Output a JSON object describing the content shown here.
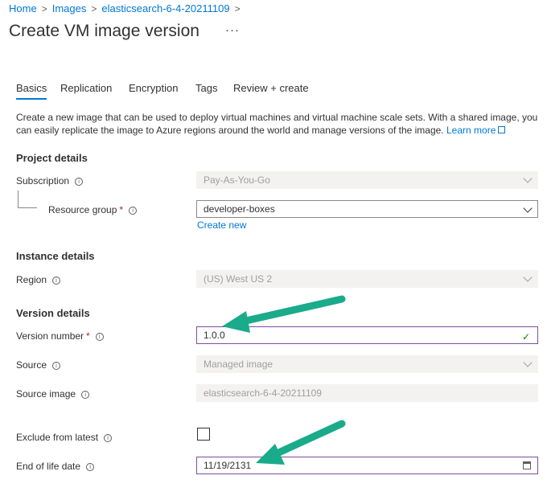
{
  "breadcrumb": {
    "home": "Home",
    "images": "Images",
    "current": "elasticsearch-6-4-20211109",
    "separator": ">"
  },
  "page": {
    "title": "Create VM image version",
    "more": "···"
  },
  "tabs": [
    {
      "label": "Basics",
      "active": true
    },
    {
      "label": "Replication",
      "active": false
    },
    {
      "label": "Encryption",
      "active": false
    },
    {
      "label": "Tags",
      "active": false
    },
    {
      "label": "Review + create",
      "active": false
    }
  ],
  "description": {
    "text": "Create a new image that can be used to deploy virtual machines and virtual machine scale sets. With a shared image, you can easily replicate the image to Azure regions around the world and manage versions of the image.",
    "link": "Learn more"
  },
  "project": {
    "heading": "Project details",
    "subscription_label": "Subscription",
    "subscription_value": "Pay-As-You-Go",
    "resource_group_label": "Resource group",
    "resource_group_value": "developer-boxes",
    "create_new": "Create new"
  },
  "instance": {
    "heading": "Instance details",
    "region_label": "Region",
    "region_value": "(US) West US 2"
  },
  "version": {
    "heading": "Version details",
    "number_label": "Version number",
    "number_value": "1.0.0",
    "source_label": "Source",
    "source_value": "Managed image",
    "source_image_label": "Source image",
    "source_image_value": "elasticsearch-6-4-20211109",
    "exclude_label": "Exclude from latest",
    "exclude_checked": false,
    "eol_label": "End of life date",
    "eol_value": "11/19/2131"
  },
  "symbols": {
    "info": "i",
    "required": "*",
    "checkmark": "✓"
  },
  "colors": {
    "accent": "#0078d4",
    "annotation_arrow": "#1aab8b",
    "required": "#a4262c",
    "valid": "#107c10"
  }
}
